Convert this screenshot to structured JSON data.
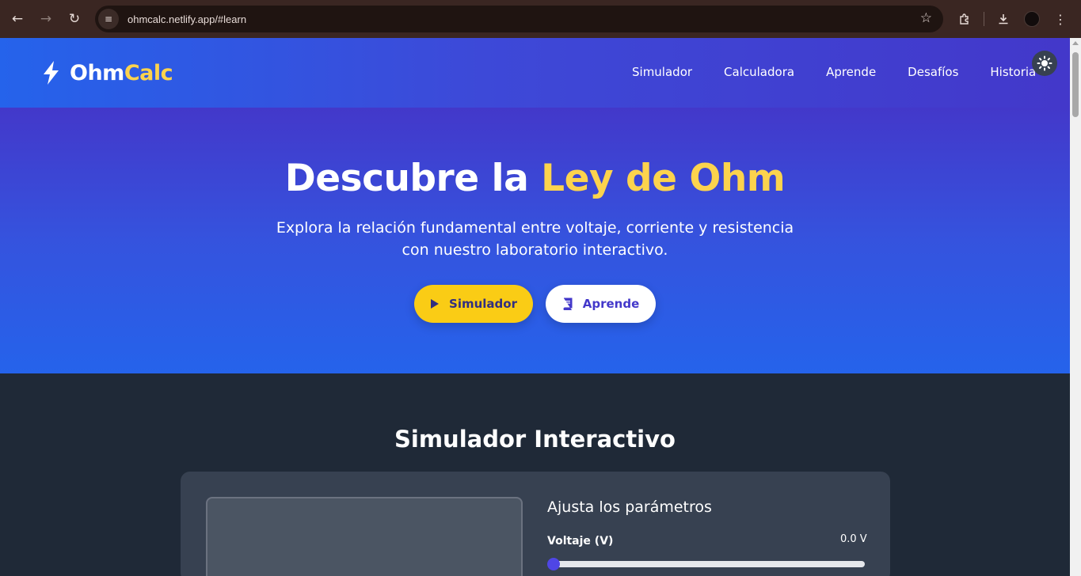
{
  "browser": {
    "url": "ohmcalc.netlify.app/#learn"
  },
  "header": {
    "logo_main": "Ohm",
    "logo_accent": "Calc",
    "nav": [
      "Simulador",
      "Calculadora",
      "Aprende",
      "Desafíos",
      "Historia"
    ]
  },
  "hero": {
    "title_main": "Descubre la ",
    "title_accent": "Ley de Ohm",
    "lead": "Explora la relación fundamental entre voltaje, corriente y resistencia con nuestro laboratorio interactivo.",
    "btn_primary": "Simulador",
    "btn_secondary": "Aprende"
  },
  "simulator": {
    "title": "Simulador Interactivo",
    "params_title": "Ajusta los parámetros",
    "voltage_label": "Voltaje (V)",
    "voltage_value": "0.0 V",
    "voltage_level": 0
  },
  "colors": {
    "accent_yellow": "#fcd34d",
    "primary_indigo": "#4338ca",
    "primary_blue": "#2563eb",
    "dark_bg": "#1f2937",
    "card_bg": "#374151"
  },
  "icons": [
    "back-arrow-icon",
    "forward-arrow-icon",
    "reload-icon",
    "site-settings-icon",
    "star-icon",
    "extensions-icon",
    "download-icon",
    "menu-dots-icon",
    "bolt-icon",
    "sun-icon",
    "play-icon",
    "book-icon"
  ]
}
